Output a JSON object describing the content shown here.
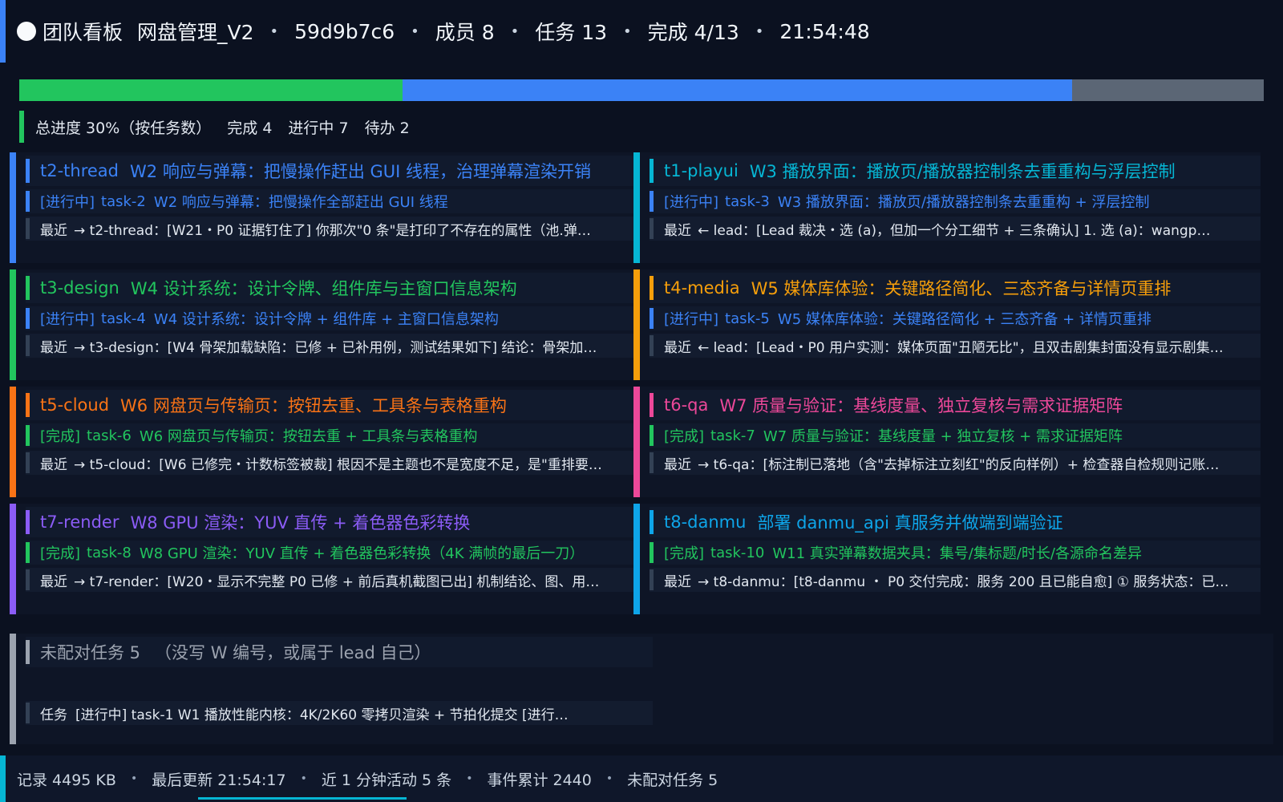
{
  "header": {
    "title": "团队看板",
    "project": "网盘管理_V2",
    "hash": "59d9b7c6",
    "members": "成员 8",
    "tasks": "任务 13",
    "done": "完成 4/13",
    "time": "21:54:48"
  },
  "progress": {
    "done_fraction": 0.308,
    "in_progress_fraction": 0.538,
    "todo_fraction": 0.154,
    "colors": {
      "done": "#22c55e",
      "in_progress": "#3b82f6",
      "todo": "#5b6675"
    }
  },
  "summary": {
    "overall": "总进度 30%（按任务数）",
    "done": "完成 4",
    "in_progress": "进行中 7",
    "todo": "待办 2"
  },
  "cards": [
    {
      "agent": "t2-thread",
      "goal": "W2 响应与弹幕：把慢操作赶出 GUI 线程，治理弹幕渲染开销",
      "status": "[进行中]",
      "task_id": "task-2",
      "task_desc": "W2 响应与弹幕：把慢操作全部赶出 GUI 线程",
      "recent_label": "最近",
      "recent": "→ t2-thread：[W21・P0 证据钉住了] 你那次\"0 条\"是打印了不存在的属性（池.弹…",
      "color": "#3b82f6",
      "status_color": "#3b82f6"
    },
    {
      "agent": "t1-playui",
      "goal": "W3 播放界面：播放页/播放器控制条去重重构与浮层控制",
      "status": "[进行中]",
      "task_id": "task-3",
      "task_desc": "W3 播放界面：播放页/播放器控制条去重重构 + 浮层控制",
      "recent_label": "最近",
      "recent": "← lead：[Lead 裁决・选 (a)，但加一个分工细节 + 三条确认] 1. 选 (a)：wangp…",
      "color": "#06b6d4",
      "status_color": "#3b82f6"
    },
    {
      "agent": "t3-design",
      "goal": "W4 设计系统：设计令牌、组件库与主窗口信息架构",
      "status": "[进行中]",
      "task_id": "task-4",
      "task_desc": "W4 设计系统：设计令牌 + 组件库 + 主窗口信息架构",
      "recent_label": "最近",
      "recent": "→ t3-design：[W4 骨架加载缺陷：已修 + 已补用例，测试结果如下] 结论：骨架加…",
      "color": "#22c55e",
      "status_color": "#3b82f6"
    },
    {
      "agent": "t4-media",
      "goal": "W5 媒体库体验：关键路径简化、三态齐备与详情页重排",
      "status": "[进行中]",
      "task_id": "task-5",
      "task_desc": "W5 媒体库体验：关键路径简化 + 三态齐备 + 详情页重排",
      "recent_label": "最近",
      "recent": "← lead：[Lead・P0 用户实测：媒体页面\"丑陋无比\"，且双击剧集封面没有显示剧集…",
      "color": "#f59e0b",
      "status_color": "#3b82f6"
    },
    {
      "agent": "t5-cloud",
      "goal": "W6 网盘页与传输页：按钮去重、工具条与表格重构",
      "status": "[完成]",
      "task_id": "task-6",
      "task_desc": "W6 网盘页与传输页：按钮去重 + 工具条与表格重构",
      "recent_label": "最近",
      "recent": "→ t5-cloud：[W6 已修完・计数标签被裁] 根因不是主题也不是宽度不足，是\"重排要…",
      "color": "#f97316",
      "status_color": "#22c55e"
    },
    {
      "agent": "t6-qa",
      "goal": "W7 质量与验证：基线度量、独立复核与需求证据矩阵",
      "status": "[完成]",
      "task_id": "task-7",
      "task_desc": "W7 质量与验证：基线度量 + 独立复核 + 需求证据矩阵",
      "recent_label": "最近",
      "recent": "→ t6-qa：[标注制已落地（含\"去掉标注立刻红\"的反向样例）+ 检查器自检规则记账…",
      "color": "#ec4899",
      "status_color": "#22c55e"
    },
    {
      "agent": "t7-render",
      "goal": "W8 GPU 渲染：YUV 直传 + 着色器色彩转换",
      "status": "[完成]",
      "task_id": "task-8",
      "task_desc": "W8 GPU 渲染：YUV 直传 + 着色器色彩转换（4K 满帧的最后一刀）",
      "recent_label": "最近",
      "recent": "→ t7-render：[W20・显示不完整 P0 已修 + 前后真机截图已出] 机制结论、图、用…",
      "color": "#8b5cf6",
      "status_color": "#22c55e"
    },
    {
      "agent": "t8-danmu",
      "goal": "部署 danmu_api 真服务并做端到端验证",
      "status": "[完成]",
      "task_id": "task-10",
      "task_desc": "W11 真实弹幕数据夹具：集号/集标题/时长/各源命名差异",
      "recent_label": "最近",
      "recent": "→ t8-danmu：[t8-danmu ・ P0 交付完成：服务 200 且已能自愈] ① 服务状态：已…",
      "color": "#0ea5e9",
      "status_color": "#22c55e"
    }
  ],
  "unmatched": {
    "count_label": "未配对任务 5",
    "note": "（没写 W 编号，或属于 lead 自己）",
    "row_label": "任务",
    "row_text": "[进行中] task-1 W1 播放性能内核：4K/2K60 零拷贝渲染 + 节拍化提交  [进行…"
  },
  "footer": {
    "log_size": "记录 4495 KB",
    "last_update": "最后更新 21:54:17",
    "activity": "近 1 分钟活动 5 条",
    "events": "事件累计 2440",
    "unmatched": "未配对任务 5"
  }
}
